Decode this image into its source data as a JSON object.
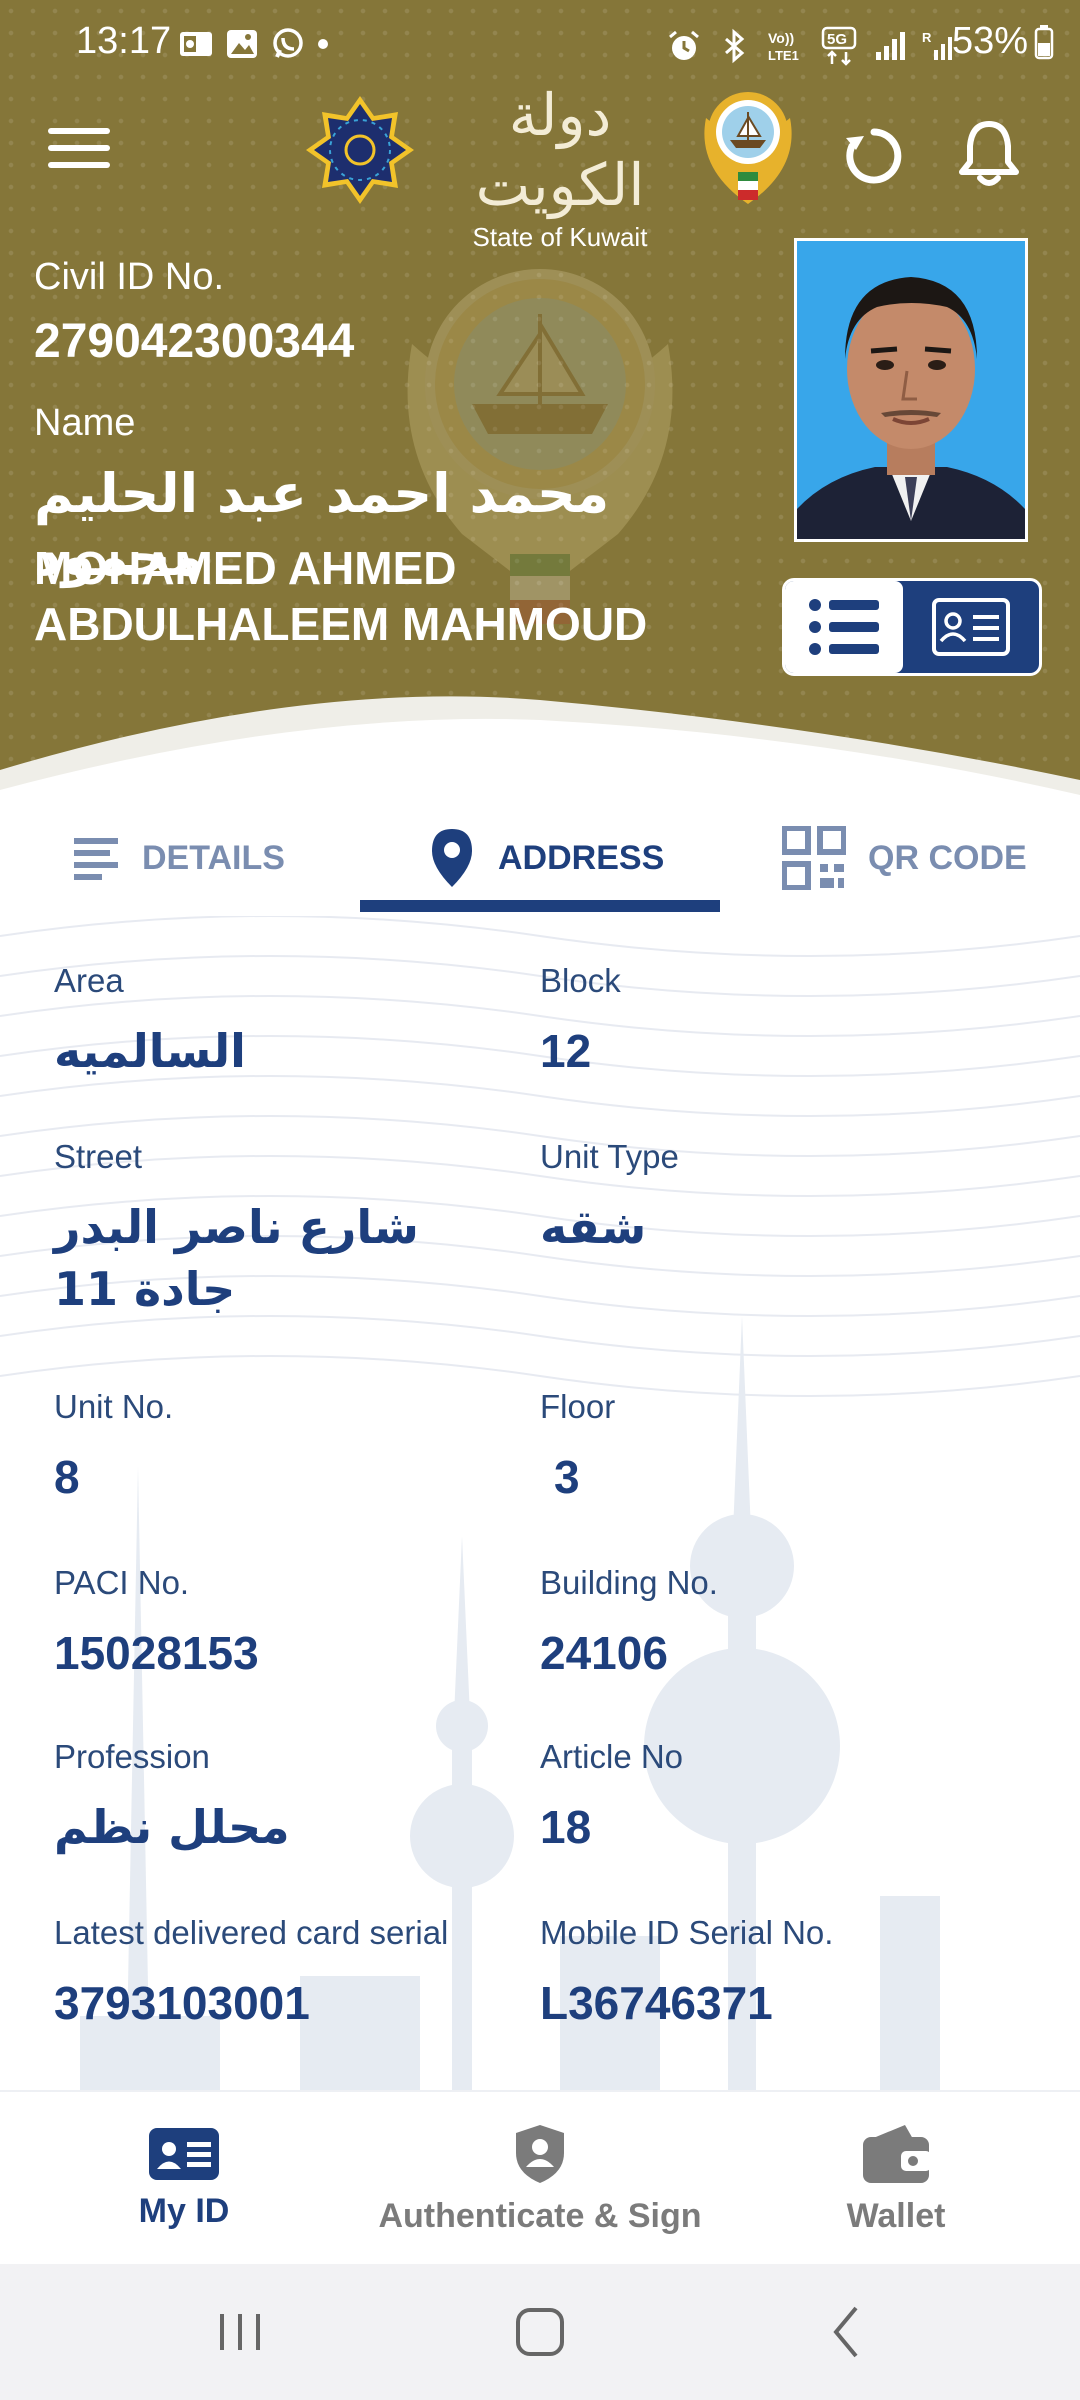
{
  "status_bar": {
    "time": "13:17",
    "battery_percent": "53%",
    "network_badge": "5G",
    "volte": "Vo)) LTE1",
    "icons_left": [
      "outlook-icon",
      "gallery-icon",
      "whatsapp-icon",
      "dot-icon"
    ],
    "icons_right": [
      "alarm-icon",
      "bluetooth-icon",
      "volte-icon",
      "5g-icon",
      "signal-icon",
      "signal-r-icon"
    ]
  },
  "header": {
    "logo_arabic": "دولة الكويت",
    "logo_english": "State of Kuwait",
    "civil_id_label": "Civil ID No.",
    "civil_id_value": "279042300344",
    "name_label": "Name",
    "name_arabic": "محمد احمد عبد الحليم محمود",
    "name_english": "MOHAMED AHMED ABDULHALEEM MAHMOUD"
  },
  "tabs": [
    {
      "label": "DETAILS",
      "icon": "list-lines-icon",
      "active": false
    },
    {
      "label": "ADDRESS",
      "icon": "location-pin-icon",
      "active": true
    },
    {
      "label": "QR CODE",
      "icon": "qr-code-icon",
      "active": false
    }
  ],
  "address": {
    "area_label": "Area",
    "area_value": "السالميه",
    "block_label": "Block",
    "block_value": "12",
    "street_label": "Street",
    "street_value": "شارع ناصر البدر جادة 11",
    "unit_type_label": "Unit Type",
    "unit_type_value": "شقه",
    "unit_no_label": "Unit No.",
    "unit_no_value": "8",
    "floor_label": "Floor",
    "floor_value": "3",
    "paci_label": "PACI No.",
    "paci_value": "15028153",
    "building_label": "Building No.",
    "building_value": "24106",
    "profession_label": "Profession",
    "profession_value": "محلل نظم",
    "article_label": "Article No",
    "article_value": "18",
    "card_serial_label": "Latest delivered card serial",
    "card_serial_value": "3793103001",
    "mobile_serial_label": "Mobile ID Serial No.",
    "mobile_serial_value": "L36746371"
  },
  "bottom_nav": [
    {
      "label": "My ID",
      "icon": "id-card-icon",
      "active": true
    },
    {
      "label": "Authenticate & Sign",
      "icon": "shield-user-icon",
      "active": false
    },
    {
      "label": "Wallet",
      "icon": "wallet-icon",
      "active": false
    }
  ],
  "colors": {
    "header_gold": "#857639",
    "primary_navy": "#1e3f7d",
    "inactive_tab": "#7a8db0",
    "inactive_nav": "#7b7b7b"
  }
}
